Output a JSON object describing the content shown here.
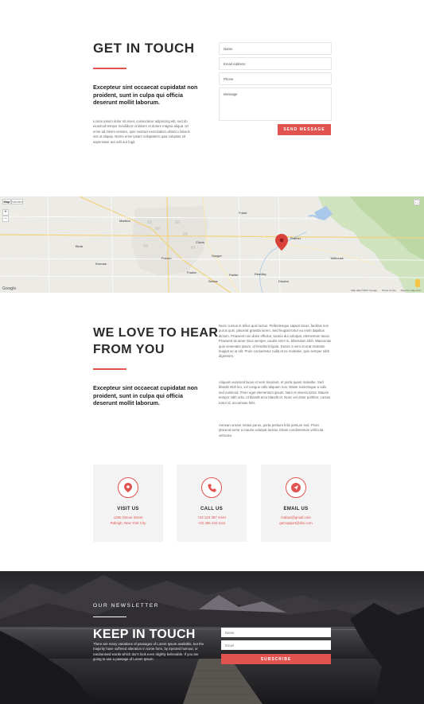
{
  "contact": {
    "title": "GET IN TOUCH",
    "lead": "Excepteur sint occaecat cupidatat non proident, sunt in culpa qui officia deserunt mollit laborum.",
    "body": "Lorem ipsum dolor sit amet, consectetur adipiscing elit, sed do eiusmod tempor incididunt ut labore et dolore magna aliqua. Ut enim ad minim veniam, quis nostrud exercitation ullamco laboris nisi ut aliquip. Nemo enim ipsam voluptatem quia voluptas sit aspernatur aut odit aut fugit.",
    "form": {
      "name_placeholder": "Name",
      "email_placeholder": "Email Address",
      "phone_placeholder": "Phone",
      "message_placeholder": "Message",
      "submit_label": "SEND MESSAGE"
    }
  },
  "map": {
    "type_map": "Map",
    "type_satellite": "Satellite",
    "zoom_in": "+",
    "zoom_out": "−",
    "footer_data": "Map data ©2017 Google",
    "footer_terms": "Terms of Use",
    "footer_report": "Report a map error",
    "logo": "Google",
    "cities": [
      {
        "name": "Fresno"
      },
      {
        "name": "Clovis"
      },
      {
        "name": "Sanger"
      },
      {
        "name": "Reedley"
      },
      {
        "name": "Kerman"
      },
      {
        "name": "Madera"
      },
      {
        "name": "Fowler"
      },
      {
        "name": "Selma"
      },
      {
        "name": "Parlier"
      },
      {
        "name": "Dinuba"
      },
      {
        "name": "Tollhouse"
      },
      {
        "name": "Prather"
      },
      {
        "name": "Biola"
      },
      {
        "name": "Friant"
      }
    ]
  },
  "love": {
    "title_line1": "WE LOVE TO HEAR",
    "title_line2": "FROM YOU",
    "lead": "Excepteur sint occaecat cupidatat non proident, sunt in culpa qui officia deserunt mollit laborum.",
    "paragraphs": [
      "Nunc cursus in tellus quis luctus. Pellentesque sapien lacus, facilisis non purus quis, placerat gravida lorem. Sed feugiat tortor eu enim dapibus dictum. Praesent non dolor efficitur, lacinia dui volutpat, elementum lacus. Praesent sit amet risus semper, iaculis enim in, bibendum nibh. Maecenas quis venenatis ipsum, id hendrerit ligula. Donec a sem ut erat molestie feugiat ac ut elit. Proin consectetur nulla et ex molestie, quis semper nibh dignissim.",
      "Aliquam euismod lacus et sem tincidunt, et porta quam molestie. Sed blandit nibh leo, vel congue odio aliquam non. Etiam scelerisque a odio sed euismod. Proin eget elementum ipsum. Nam et viverra tortor. Mauris tempor nibh odio, id blandit arcu blandit et. Nunc vel dolor porttitor, cursus tortor id, accumsan felis.",
      "Aenean ornare metus purus, porta pretium felis pretium sed. Proin placerat tortor a mauris volutpat lacinia. Etiam condimentum vehicula vehicula."
    ]
  },
  "cards": [
    {
      "icon": "map-pin-icon",
      "title": "VISIT US",
      "line1": "1290 Dimon Street",
      "line2": "Raleigh, New York City"
    },
    {
      "icon": "phone-icon",
      "title": "CALL US",
      "line1": "+22 123 387 4444",
      "line2": "+22 456 234 1111"
    },
    {
      "icon": "send-icon",
      "title": "EMAIL US",
      "line1": "mattus@gmail.com",
      "line2": "getsupport@divi.com"
    }
  ],
  "newsletter": {
    "label": "OUR NEWSLETTER",
    "title": "KEEP IN TOUCH",
    "text": "There are many variations of passages of Lorem Ipsum available, but the majority have suffered alteration in some form, by injected humour, or randomised words which don't look even slightly believable. If you are going to use a passage of Lorem Ipsum.",
    "name_placeholder": "Name",
    "email_placeholder": "Email",
    "button_label": "SUBSCRIBE"
  },
  "colors": {
    "accent": "#e0534f",
    "dark_text": "#2a2a2a",
    "card_bg": "#f3f3f3"
  }
}
